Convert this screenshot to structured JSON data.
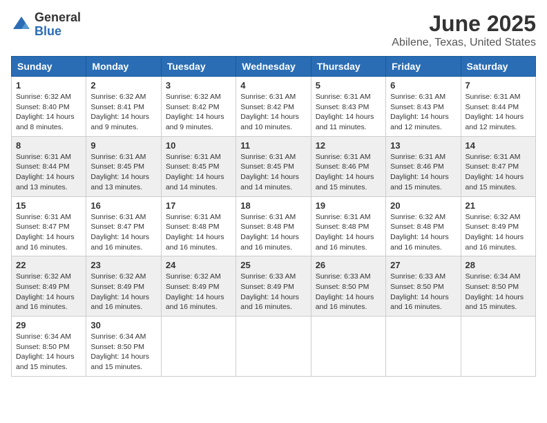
{
  "header": {
    "logo_general": "General",
    "logo_blue": "Blue",
    "title": "June 2025",
    "subtitle": "Abilene, Texas, United States"
  },
  "calendar": {
    "days_of_week": [
      "Sunday",
      "Monday",
      "Tuesday",
      "Wednesday",
      "Thursday",
      "Friday",
      "Saturday"
    ],
    "weeks": [
      [
        {
          "day": "1",
          "sunrise": "6:32 AM",
          "sunset": "8:40 PM",
          "daylight": "14 hours and 8 minutes."
        },
        {
          "day": "2",
          "sunrise": "6:32 AM",
          "sunset": "8:41 PM",
          "daylight": "14 hours and 9 minutes."
        },
        {
          "day": "3",
          "sunrise": "6:32 AM",
          "sunset": "8:42 PM",
          "daylight": "14 hours and 9 minutes."
        },
        {
          "day": "4",
          "sunrise": "6:31 AM",
          "sunset": "8:42 PM",
          "daylight": "14 hours and 10 minutes."
        },
        {
          "day": "5",
          "sunrise": "6:31 AM",
          "sunset": "8:43 PM",
          "daylight": "14 hours and 11 minutes."
        },
        {
          "day": "6",
          "sunrise": "6:31 AM",
          "sunset": "8:43 PM",
          "daylight": "14 hours and 12 minutes."
        },
        {
          "day": "7",
          "sunrise": "6:31 AM",
          "sunset": "8:44 PM",
          "daylight": "14 hours and 12 minutes."
        }
      ],
      [
        {
          "day": "8",
          "sunrise": "6:31 AM",
          "sunset": "8:44 PM",
          "daylight": "14 hours and 13 minutes."
        },
        {
          "day": "9",
          "sunrise": "6:31 AM",
          "sunset": "8:45 PM",
          "daylight": "14 hours and 13 minutes."
        },
        {
          "day": "10",
          "sunrise": "6:31 AM",
          "sunset": "8:45 PM",
          "daylight": "14 hours and 14 minutes."
        },
        {
          "day": "11",
          "sunrise": "6:31 AM",
          "sunset": "8:45 PM",
          "daylight": "14 hours and 14 minutes."
        },
        {
          "day": "12",
          "sunrise": "6:31 AM",
          "sunset": "8:46 PM",
          "daylight": "14 hours and 15 minutes."
        },
        {
          "day": "13",
          "sunrise": "6:31 AM",
          "sunset": "8:46 PM",
          "daylight": "14 hours and 15 minutes."
        },
        {
          "day": "14",
          "sunrise": "6:31 AM",
          "sunset": "8:47 PM",
          "daylight": "14 hours and 15 minutes."
        }
      ],
      [
        {
          "day": "15",
          "sunrise": "6:31 AM",
          "sunset": "8:47 PM",
          "daylight": "14 hours and 16 minutes."
        },
        {
          "day": "16",
          "sunrise": "6:31 AM",
          "sunset": "8:47 PM",
          "daylight": "14 hours and 16 minutes."
        },
        {
          "day": "17",
          "sunrise": "6:31 AM",
          "sunset": "8:48 PM",
          "daylight": "14 hours and 16 minutes."
        },
        {
          "day": "18",
          "sunrise": "6:31 AM",
          "sunset": "8:48 PM",
          "daylight": "14 hours and 16 minutes."
        },
        {
          "day": "19",
          "sunrise": "6:31 AM",
          "sunset": "8:48 PM",
          "daylight": "14 hours and 16 minutes."
        },
        {
          "day": "20",
          "sunrise": "6:32 AM",
          "sunset": "8:48 PM",
          "daylight": "14 hours and 16 minutes."
        },
        {
          "day": "21",
          "sunrise": "6:32 AM",
          "sunset": "8:49 PM",
          "daylight": "14 hours and 16 minutes."
        }
      ],
      [
        {
          "day": "22",
          "sunrise": "6:32 AM",
          "sunset": "8:49 PM",
          "daylight": "14 hours and 16 minutes."
        },
        {
          "day": "23",
          "sunrise": "6:32 AM",
          "sunset": "8:49 PM",
          "daylight": "14 hours and 16 minutes."
        },
        {
          "day": "24",
          "sunrise": "6:32 AM",
          "sunset": "8:49 PM",
          "daylight": "14 hours and 16 minutes."
        },
        {
          "day": "25",
          "sunrise": "6:33 AM",
          "sunset": "8:49 PM",
          "daylight": "14 hours and 16 minutes."
        },
        {
          "day": "26",
          "sunrise": "6:33 AM",
          "sunset": "8:50 PM",
          "daylight": "14 hours and 16 minutes."
        },
        {
          "day": "27",
          "sunrise": "6:33 AM",
          "sunset": "8:50 PM",
          "daylight": "14 hours and 16 minutes."
        },
        {
          "day": "28",
          "sunrise": "6:34 AM",
          "sunset": "8:50 PM",
          "daylight": "14 hours and 15 minutes."
        }
      ],
      [
        {
          "day": "29",
          "sunrise": "6:34 AM",
          "sunset": "8:50 PM",
          "daylight": "14 hours and 15 minutes."
        },
        {
          "day": "30",
          "sunrise": "6:34 AM",
          "sunset": "8:50 PM",
          "daylight": "14 hours and 15 minutes."
        },
        null,
        null,
        null,
        null,
        null
      ]
    ]
  }
}
